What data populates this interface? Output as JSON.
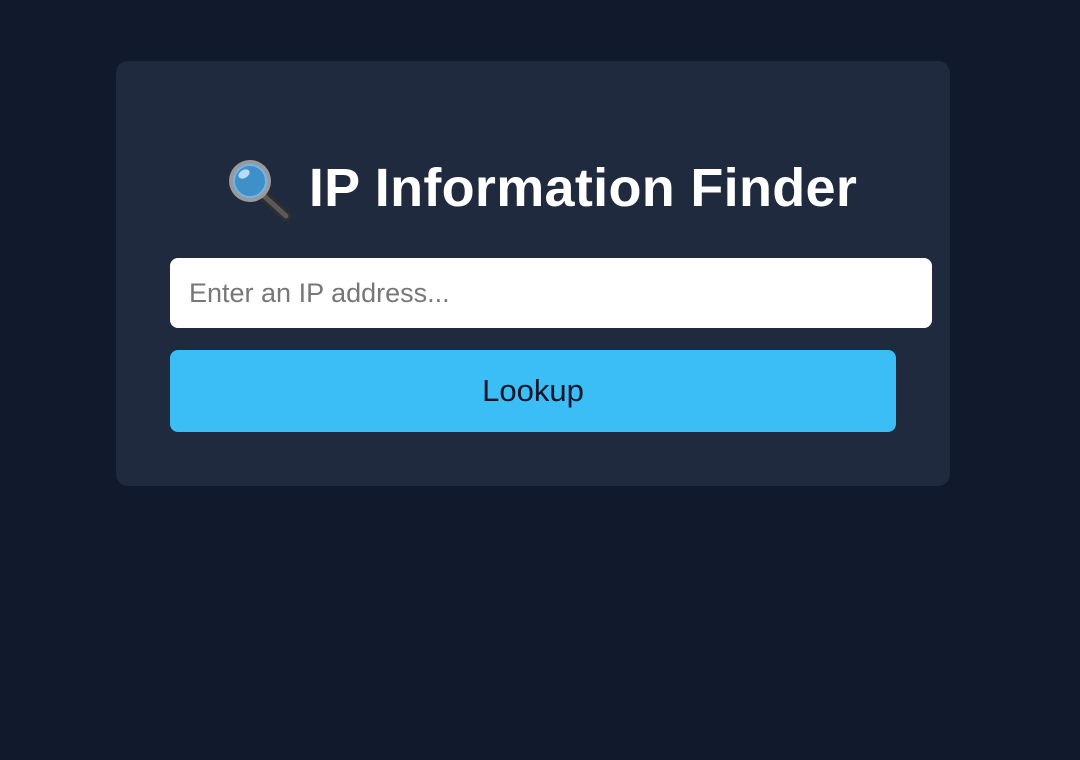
{
  "app": {
    "title": "IP Information Finder",
    "title_icon": "magnifying-glass-icon"
  },
  "search": {
    "placeholder": "Enter an IP address...",
    "value": ""
  },
  "actions": {
    "lookup_label": "Lookup"
  },
  "colors": {
    "page_background": "#111a2c",
    "card_background": "#1f2a3e",
    "button_accent": "#3bbdf6",
    "title_text": "#ffffff"
  }
}
